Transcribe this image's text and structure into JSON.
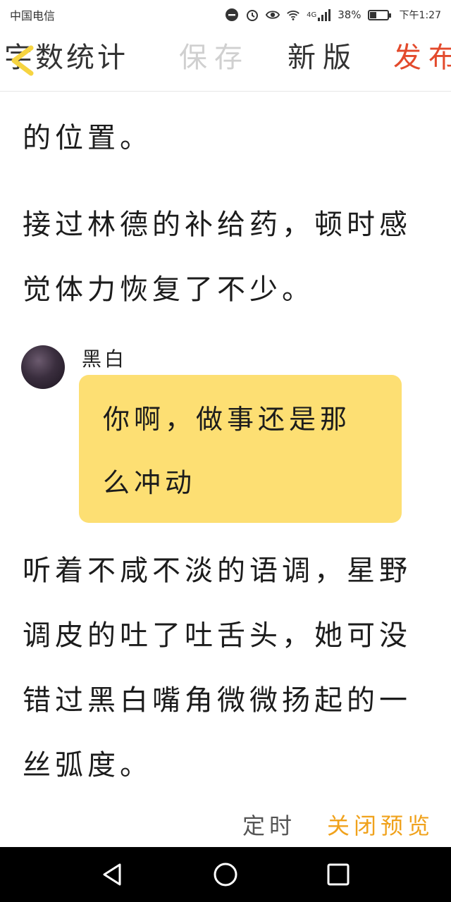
{
  "status_bar": {
    "carrier": "中国电信",
    "network": "4G",
    "battery_pct": "38%",
    "battery_level": 0.38,
    "time": "下午1:27",
    "icons": [
      "minus-circle-icon",
      "alarm-icon",
      "eye-icon",
      "wifi-icon",
      "signal-icon",
      "battery-icon"
    ]
  },
  "toolbar": {
    "title": "字数统计",
    "save": "保存",
    "new_version": "新版",
    "publish": "发布",
    "colors": {
      "publish": "#e34a2c",
      "save_disabled": "#d0d0d0"
    }
  },
  "content": {
    "p1": "的位置。",
    "p2": "接过林德的补给药，顿时感觉体力恢复了不少。",
    "dialog": {
      "speaker": "黑白",
      "text": "你啊，做事还是那么冲动",
      "bubble_color": "#fddf73"
    },
    "p3": "听着不咸不淡的语调，星野调皮的吐了吐舌头，她可没错过黑白嘴角微微扬起的一丝弧度。"
  },
  "actions": {
    "timer": "定时",
    "close_preview": "关闭预览",
    "colors": {
      "close_preview": "#f0a21c"
    }
  },
  "navbar": {
    "icons": [
      "back-triangle-icon",
      "home-circle-icon",
      "recents-square-icon"
    ]
  }
}
